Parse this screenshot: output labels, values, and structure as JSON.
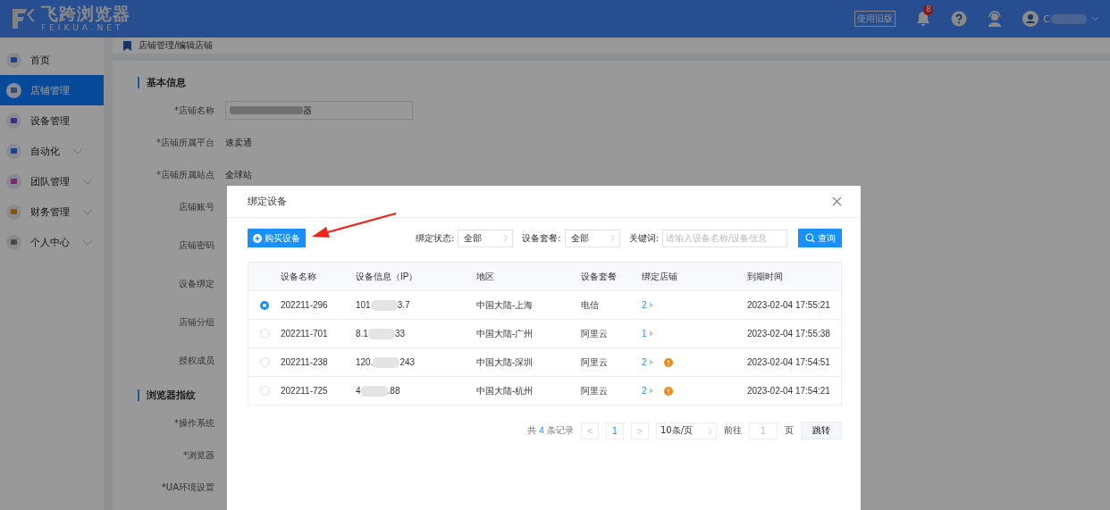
{
  "header": {
    "logo_text": "飞跨浏览器",
    "logo_sub": "FEIKUA.NET",
    "old_version": "使用旧版",
    "notification_count": "8",
    "user_name": "C"
  },
  "sidebar": {
    "items": [
      {
        "label": "首页",
        "selected": false,
        "has_submenu": false
      },
      {
        "label": "店铺管理",
        "selected": true,
        "has_submenu": false
      },
      {
        "label": "设备管理",
        "selected": false,
        "has_submenu": false
      },
      {
        "label": "自动化",
        "selected": false,
        "has_submenu": true
      },
      {
        "label": "团队管理",
        "selected": false,
        "has_submenu": true
      },
      {
        "label": "财务管理",
        "selected": false,
        "has_submenu": true
      },
      {
        "label": "个人中心",
        "selected": false,
        "has_submenu": true
      }
    ]
  },
  "breadcrumb": "店铺管理/编辑店铺",
  "form": {
    "sections": [
      {
        "title": "基本信息",
        "fields": [
          {
            "label": "*店铺名称",
            "kind": "input",
            "value": "器"
          },
          {
            "label": "*店铺所属平台",
            "kind": "text",
            "value": "速卖通"
          },
          {
            "label": "*店铺所属站点",
            "kind": "text",
            "value": "全球站"
          },
          {
            "label": "店铺账号",
            "kind": "empty"
          },
          {
            "label": "店铺密码",
            "kind": "empty"
          },
          {
            "label": "设备绑定",
            "kind": "empty"
          },
          {
            "label": "店铺分组",
            "kind": "empty"
          },
          {
            "label": "授权成员",
            "kind": "empty"
          }
        ]
      },
      {
        "title": "浏览器指纹",
        "fields": [
          {
            "label": "*操作系统",
            "kind": "empty"
          },
          {
            "label": "*浏览器",
            "kind": "empty"
          },
          {
            "label": "*UA环境设置",
            "kind": "empty"
          }
        ]
      }
    ]
  },
  "dialog": {
    "title": "绑定设备",
    "buy_button": "购买设备",
    "filters": [
      {
        "label": "绑定状态:",
        "value": "全部"
      },
      {
        "label": "设备套餐:",
        "value": "全部"
      }
    ],
    "keyword": {
      "label": "关键词:",
      "placeholder": "请输入设备名称/设备信息"
    },
    "search_button": "查询",
    "table": {
      "columns": [
        "设备名称",
        "设备信息（IP）",
        "地区",
        "设备套餐",
        "绑定店铺",
        "到期时间"
      ],
      "rows": [
        {
          "selected": true,
          "name": "202211-296",
          "ip_start": "101",
          "ip_end": "3.7",
          "region": "中国大陆-上海",
          "plan": "电信",
          "shops": "2",
          "warning": false,
          "expires": "2023-02-04 17:55:21"
        },
        {
          "selected": false,
          "name": "202211-701",
          "ip_start": "8.1",
          "ip_end": "33",
          "region": "中国大陆-广州",
          "plan": "阿里云",
          "shops": "1",
          "warning": false,
          "expires": "2023-02-04 17:55:38"
        },
        {
          "selected": false,
          "name": "202211-238",
          "ip_start": "120.",
          "ip_end": "243",
          "region": "中国大陆-深圳",
          "plan": "阿里云",
          "shops": "2",
          "warning": true,
          "expires": "2023-02-04 17:54:51"
        },
        {
          "selected": false,
          "name": "202211-725",
          "ip_start": "4",
          "ip_end": ".88",
          "region": "中国大陆-杭州",
          "plan": "阿里云",
          "shops": "2",
          "warning": true,
          "expires": "2023-02-04 17:54:21"
        }
      ]
    },
    "pagination": {
      "total_prefix": "共",
      "total": "4",
      "total_suffix": "条记录",
      "prev": "<",
      "page": "1",
      "next": ">",
      "page_size": "10条/页",
      "goto_label": "前往",
      "goto_value": "1",
      "page_unit": "页",
      "jump_button": "跳转"
    }
  }
}
